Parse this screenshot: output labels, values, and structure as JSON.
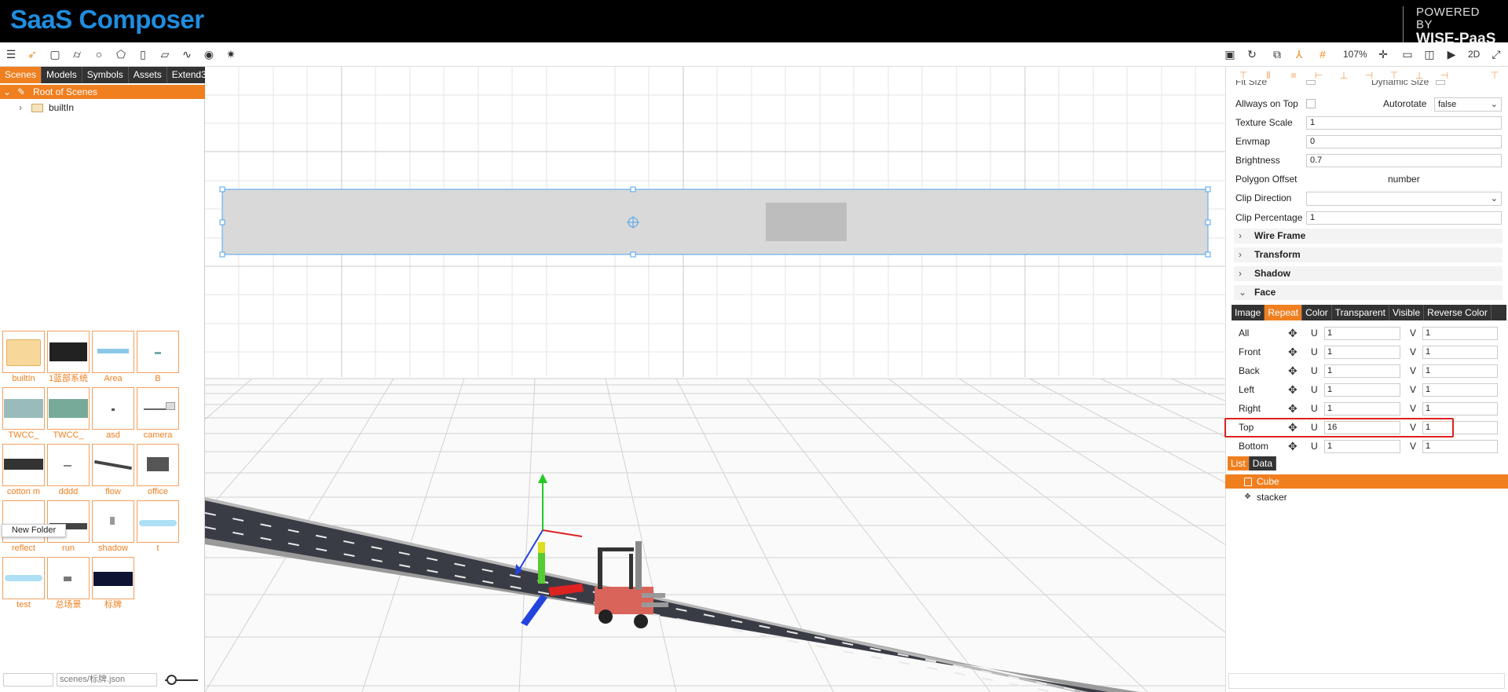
{
  "header": {
    "logo": "SaaS Composer",
    "powered_small": "POWERED BY",
    "powered_big": "WISE-PaaS"
  },
  "toolbar": {
    "zoom": "107%",
    "view_mode": "2D"
  },
  "left": {
    "tabs": [
      "Scenes",
      "Models",
      "Symbols",
      "Assets",
      "Extend3"
    ],
    "root_label": "Root of Scenes",
    "builtin_label": "builtIn",
    "assets": [
      "builtIn",
      "1蓝部系统",
      "Area",
      "B",
      "TWCC_",
      "TWCC_",
      "asd",
      "camera",
      "cotton m",
      "dddd",
      "flow",
      "office",
      "reflect",
      "run",
      "shadow",
      "t",
      "test",
      "总场景",
      "标牌"
    ],
    "tooltip": "New Folder",
    "path": "scenes/标牌.json"
  },
  "right": {
    "partial_label_1": "Fit Size",
    "partial_label_2": "Dynamic Size",
    "always_on_top": "Allways on Top",
    "autorotate_label": "Autorotate",
    "autorotate_value": "false",
    "texture_scale_label": "Texture Scale",
    "texture_scale": "1",
    "envmap_label": "Envmap",
    "envmap": "0",
    "brightness_label": "Brightness",
    "brightness": "0.7",
    "polygon_offset_label": "Polygon Offset",
    "polygon_offset_value": "number",
    "clip_direction_label": "Clip Direction",
    "clip_direction": "",
    "clip_percentage_label": "Clip Percentage",
    "clip_percentage": "1",
    "sections": [
      "Wire Frame",
      "Transform",
      "Shadow",
      "Face"
    ],
    "face_tabs": [
      "Image",
      "Repeat",
      "Color",
      "Transparent",
      "Visible",
      "Reverse Color"
    ],
    "u_label": "U",
    "v_label": "V",
    "faces": [
      {
        "name": "All",
        "u": "1",
        "v": "1"
      },
      {
        "name": "Front",
        "u": "1",
        "v": "1"
      },
      {
        "name": "Back",
        "u": "1",
        "v": "1"
      },
      {
        "name": "Left",
        "u": "1",
        "v": "1"
      },
      {
        "name": "Right",
        "u": "1",
        "v": "1"
      },
      {
        "name": "Top",
        "u": "16",
        "v": "1"
      },
      {
        "name": "Bottom",
        "u": "1",
        "v": "1"
      }
    ],
    "list_tabs": [
      "List",
      "Data"
    ],
    "list_items": [
      "Cube",
      "stacker"
    ]
  },
  "colors": {
    "accent": "#f07f1f",
    "brand_blue": "#1f8de0",
    "header_bg": "#000000",
    "highlight": "#e02020"
  }
}
